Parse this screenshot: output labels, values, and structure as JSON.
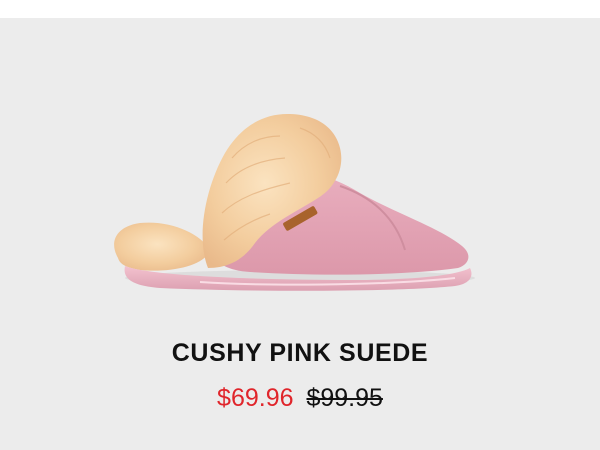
{
  "product": {
    "name": "CUSHY PINK SUEDE",
    "sale_price": "$69.96",
    "original_price": "$99.95",
    "image_icon": "slipper-product-image"
  },
  "colors": {
    "background": "#ececec",
    "sale_price": "#e0252b",
    "text": "#111111",
    "suede": "#e7a9b9",
    "fur": "#f5d3a7"
  }
}
